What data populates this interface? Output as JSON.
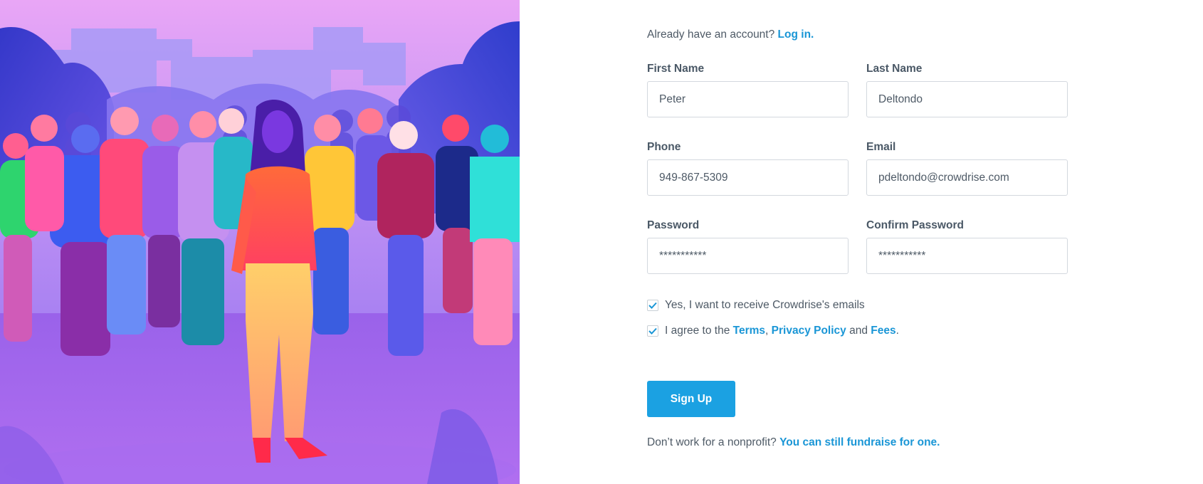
{
  "signin": {
    "prompt": "Already have an account?",
    "link": "Log in."
  },
  "fields": {
    "first_name": {
      "label": "First Name",
      "value": "Peter"
    },
    "last_name": {
      "label": "Last Name",
      "value": "Deltondo"
    },
    "phone": {
      "label": "Phone",
      "value": "949-867-5309"
    },
    "email": {
      "label": "Email",
      "value": "pdeltondo@crowdrise.com"
    },
    "password": {
      "label": "Password",
      "value": "***********"
    },
    "confirm_password": {
      "label": "Confirm Password",
      "value": "***********"
    }
  },
  "checkboxes": {
    "emails": {
      "label": "Yes, I want to receive Crowdrise's emails",
      "checked": true
    },
    "terms": {
      "prefix": "I agree to the",
      "terms_link": "Terms",
      "comma": ",",
      "privacy_link": "Privacy Policy",
      "and": "and",
      "fees_link": "Fees",
      "suffix": ".",
      "checked": true
    }
  },
  "signup_button": "Sign Up",
  "footer": {
    "prompt": "Don’t work for a nonprofit?",
    "link": "You can still fundraise for one."
  },
  "colors": {
    "accent": "#1ba1e2",
    "link": "#1a96d6",
    "text": "#4e5a66",
    "input_border": "#d3d8de"
  },
  "icons": {
    "checkmark": "check-icon"
  }
}
